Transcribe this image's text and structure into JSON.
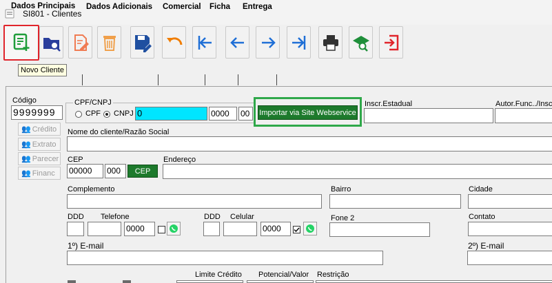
{
  "window": {
    "title": "SI801 - Clientes"
  },
  "toolbar": {
    "tooltip": "Novo Cliente",
    "buttons": [
      {
        "icon": "new-document-icon",
        "color": "#1f9d3a"
      },
      {
        "icon": "folder-search-icon",
        "color": "#2a3e9c"
      },
      {
        "icon": "edit-document-icon",
        "color": "#f07b52"
      },
      {
        "icon": "trash-icon",
        "color": "#f0a04b"
      },
      {
        "icon": "save-edit-icon",
        "color": "#1f4fa0"
      },
      {
        "icon": "undo-icon",
        "color": "#f07d00"
      },
      {
        "icon": "first-record-icon",
        "color": "#1f6fd6"
      },
      {
        "icon": "previous-record-icon",
        "color": "#1f6fd6"
      },
      {
        "icon": "next-record-icon",
        "color": "#1f6fd6"
      },
      {
        "icon": "last-record-icon",
        "color": "#1f6fd6"
      },
      {
        "icon": "printer-icon",
        "color": "#333333"
      },
      {
        "icon": "book-search-icon",
        "color": "#1f8f3a"
      },
      {
        "icon": "exit-icon",
        "color": "#e0242b"
      }
    ]
  },
  "tabs": [
    "Dados Principais",
    "Dados Adicionais",
    "Comercial",
    "Ficha",
    "Entrega"
  ],
  "form": {
    "codigo_label": "Código",
    "codigo_value": "9999999",
    "side_buttons": [
      "Crédito",
      "Extrato",
      "Parecer",
      "Financ"
    ],
    "cpf_cnpj_label": "CPF/CNPJ",
    "cpf_label": "CPF",
    "cnpj_label": "CNPJ",
    "cnpj_value": "0",
    "cnpj_branch_value": "0000",
    "cnpj_check_value": "00",
    "import_button": "Importar via Site Webservice",
    "inscr_estadual_label": "Inscr.Estadual",
    "autor_func_label": "Autor.Func../Insc",
    "nome_label": "Nome do cliente/Razão Social",
    "cep_label": "CEP",
    "cep_value_1": "00000",
    "cep_value_2": "000",
    "cep_button": "CEP",
    "endereco_label": "Endereço",
    "complemento_label": "Complemento",
    "bairro_label": "Bairro",
    "cidade_label": "Cidade",
    "ddd_label_1": "DDD",
    "telefone_label": "Telefone",
    "telefone_value": "0000",
    "ddd_label_2": "DDD",
    "celular_label": "Celular",
    "celular_value": "0000",
    "fone2_label": "Fone 2",
    "contato_label": "Contato",
    "email1_label": "1º) E-mail",
    "email2_label": "2º) E-mail",
    "limite_credito_label": "Limite Crédito",
    "potencial_valor_label": "Potencial/Valor",
    "restricao_label": "Restrição"
  },
  "colors": {
    "accent_green": "#1d7a2c",
    "highlight_cyan": "#00e5ff",
    "active_border": "#e0242b",
    "import_highlight": "#2fa84a"
  }
}
